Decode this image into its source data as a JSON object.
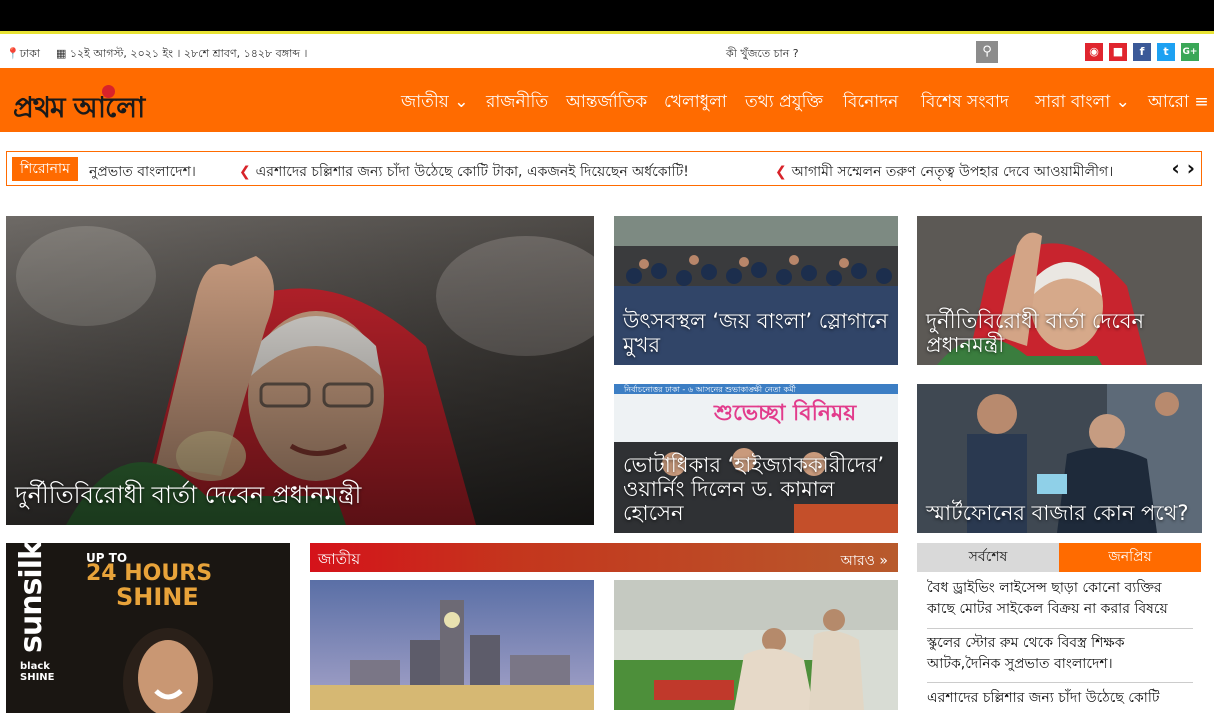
{
  "topbar": {
    "location": "ঢাকা",
    "date": "১২ই আগস্ট, ২০২১ ইং । ২৮শে শ্রাবণ, ১৪২৮ বঙ্গাব্দ ।",
    "search_placeholder": "কী খুঁজতে চান ?",
    "social": [
      {
        "icon": "camera-icon",
        "color": "#e0252e"
      },
      {
        "icon": "video-icon",
        "color": "#e0252e"
      },
      {
        "icon": "facebook-icon",
        "glyph": "f",
        "color": "#3b5998"
      },
      {
        "icon": "twitter-icon",
        "color": "#1da1f2"
      },
      {
        "icon": "googleplus-icon",
        "glyph": "G+",
        "color": "#3aa757"
      }
    ]
  },
  "brand": {
    "logo_text": "প্রথম আলো",
    "colors": {
      "accent": "#ff6b00",
      "red": "#d8232a"
    }
  },
  "nav": {
    "items": [
      "জাতীয়",
      "রাজনীতি",
      "আন্তর্জাতিক",
      "খেলাধুলা",
      "তথ্য প্রযুক্তি",
      "বিনোদন",
      "বিশেষ সংবাদ",
      "সারা বাংলা",
      "আরো"
    ]
  },
  "ticker": {
    "label": "শিরোনাম",
    "items": [
      "নুপ্রভাত বাংলাদেশ।",
      "এরশাদের চল্লিশার জন্য চাঁদা উঠেছে কোটি টাকা, একজনই দিয়েছেন অর্ধকোটি!",
      "আগামী সম্মেলন তরুণ নেতৃত্ব উপহার দেবে আওয়ামীলীগ।"
    ]
  },
  "headlines": {
    "main": "দুর্নীতিবিরোধী বার্তা দেবেন প্রধানমন্ত্রী",
    "c1": "উৎসবস্থল ‘জয় বাংলা’ স্লোগানে মুখর",
    "c2": "দুর্নীতিবিরোধী বার্তা দেবেন প্রধানমন্ত্রী",
    "c3": "ভোটাধিকার ‘হাইজ্যাককারীদের’ ওয়ার্নিং দিলেন ড. কামাল হোসেন",
    "c4": "স্মার্টফোনের বাজার কোন পথে?"
  },
  "banner_text": {
    "c3_banner": "শুভেচ্ছা বিনিময়",
    "c3_top": "নির্বাচনোত্তর ঢাকা - ৬ আসনের শুভাকাঙ্ক্ষী নেতা কর্মী"
  },
  "ad": {
    "brand": "sunsilk",
    "line1": "UP TO",
    "line2": "24 HOURS",
    "line3": "SHINE",
    "sub1": "black",
    "sub2": "SHINE"
  },
  "section": {
    "title": "জাতীয়",
    "more": "আরও »"
  },
  "tabs": {
    "latest": "সর্বশেষ",
    "popular": "জনপ্রিয়"
  },
  "sidebar_list": [
    "বৈধ ড্রাইভিং লাইসেন্স ছাড়া কোনো ব্যক্তির কাছে মোটর সাইকেল বিক্রয় না করার বিষয়ে",
    "স্কুলের স্টোর রুম থেকে বিবস্ত্র শিক্ষক আটক,দৈনিক সুপ্রভাত বাংলাদেশ।",
    "এরশাদের চল্লিশার জন্য চাঁদা উঠেছে কোটি"
  ]
}
